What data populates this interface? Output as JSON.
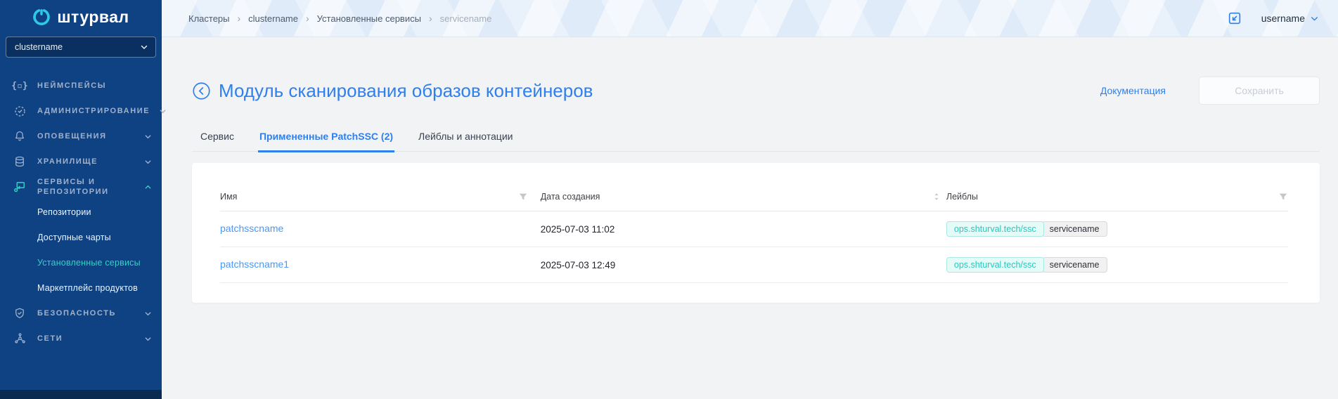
{
  "app": {
    "logo_text": "штурвал"
  },
  "sidebar": {
    "cluster_select": {
      "value": "clustername"
    },
    "items": [
      {
        "label": "НЕЙМСПЕЙСЫ",
        "icon": "braces-icon"
      },
      {
        "label": "АДМИНИСТРИРОВАНИЕ",
        "icon": "gear-icon"
      },
      {
        "label": "ОПОВЕЩЕНИЯ",
        "icon": "bell-icon"
      },
      {
        "label": "ХРАНИЛИЩЕ",
        "icon": "database-icon"
      },
      {
        "label": "СЕРВИСЫ И РЕПОЗИТОРИИ",
        "icon": "services-icon",
        "expanded": true,
        "children": [
          "Репозитории",
          "Доступные чарты",
          "Установленные сервисы",
          "Маркетплейс продуктов"
        ],
        "active_child": "Установленные сервисы"
      },
      {
        "label": "БЕЗОПАСНОСТЬ",
        "icon": "shield-icon"
      },
      {
        "label": "СЕТИ",
        "icon": "network-icon"
      }
    ]
  },
  "header": {
    "breadcrumb": [
      "Кластеры",
      "clustername",
      "Установленные сервисы",
      "servicename"
    ],
    "username": "username"
  },
  "page": {
    "title": "Модуль сканирования образов контейнеров",
    "docs_link": "Документация",
    "save_button": "Сохранить"
  },
  "tabs": [
    {
      "label": "Сервис",
      "active": false
    },
    {
      "label": "Примененные PatchSSC (2)",
      "active": true
    },
    {
      "label": "Лейблы и аннотации",
      "active": false
    }
  ],
  "table": {
    "columns": [
      "Имя",
      "Дата создания",
      "Лейблы"
    ],
    "rows": [
      {
        "name": "patchsscname",
        "created": "2025-07-03 11:02",
        "labels": [
          {
            "key": "ops.shturval.tech/ssc",
            "value": "servicename"
          }
        ]
      },
      {
        "name": "patchsscname1",
        "created": "2025-07-03 12:49",
        "labels": [
          {
            "key": "ops.shturval.tech/ssc",
            "value": "servicename"
          }
        ]
      }
    ]
  },
  "colors": {
    "accent_blue": "#2f80ed",
    "accent_teal": "#35d1c6",
    "sidebar_bg": "#0e4282",
    "chip_teal_text": "#2cc6bc",
    "chip_teal_bg": "#e4fbf8",
    "link_blue": "#4a97f5"
  }
}
